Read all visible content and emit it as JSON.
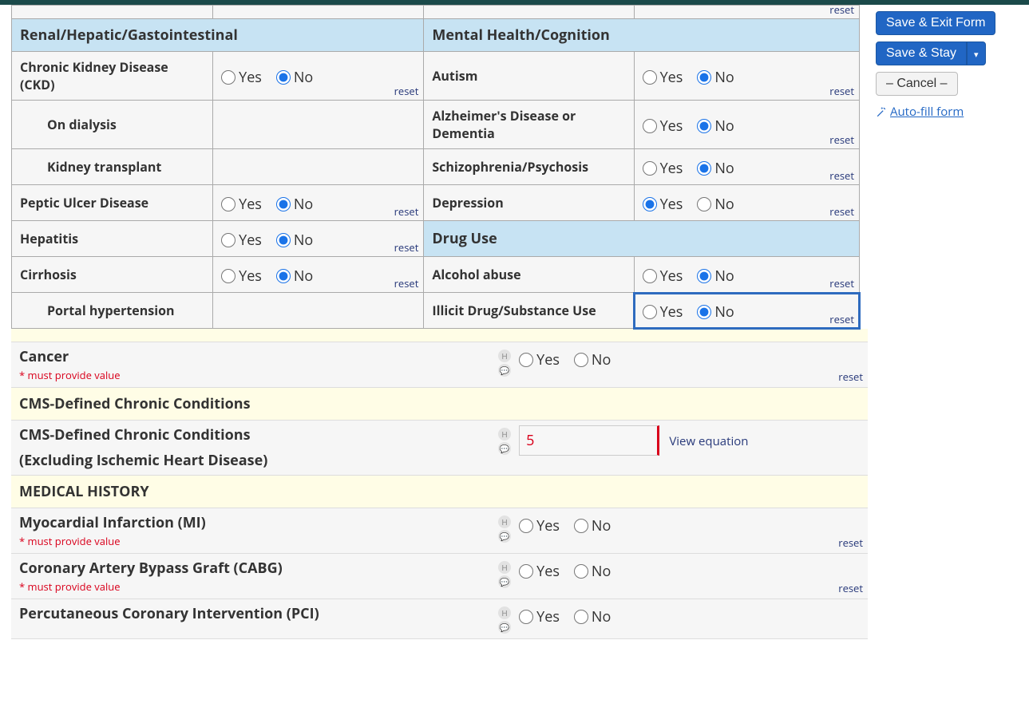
{
  "labels": {
    "yes": "Yes",
    "no": "No",
    "reset": "reset",
    "must": "* must provide value",
    "view_eq": "View equation"
  },
  "sections": {
    "renal_hdr": "Renal/Hepatic/Gastointestinal",
    "mental_hdr": "Mental Health/Cognition",
    "drug_hdr": "Drug Use"
  },
  "grid_left": [
    {
      "key": "ckd",
      "label": "Chronic Kidney Disease (CKD)",
      "selected": "no",
      "reset": true
    },
    {
      "key": "dialysis",
      "label": "On dialysis",
      "indent": true,
      "selected": null,
      "reset": false
    },
    {
      "key": "kidney_tx",
      "label": "Kidney transplant",
      "indent": true,
      "selected": null,
      "reset": false
    },
    {
      "key": "peptic",
      "label": "Peptic Ulcer Disease",
      "selected": "no",
      "reset": true
    },
    {
      "key": "hepatitis",
      "label": "Hepatitis",
      "selected": "no",
      "reset": true
    },
    {
      "key": "cirrhosis",
      "label": "Cirrhosis",
      "selected": "no",
      "reset": true
    },
    {
      "key": "portal_htn",
      "label": "Portal hypertension",
      "indent": true,
      "selected": null,
      "reset": false
    }
  ],
  "grid_right": [
    {
      "key": "autism",
      "label": "Autism",
      "selected": "no",
      "reset": true
    },
    {
      "key": "alz",
      "label": "Alzheimer's Disease or Dementia",
      "selected": "no",
      "reset": true
    },
    {
      "key": "schizo",
      "label": "Schizophrenia/Psychosis",
      "selected": "no",
      "reset": true
    },
    {
      "key": "depress",
      "label": "Depression",
      "selected": "yes",
      "reset": true
    },
    {
      "key": "alcohol",
      "label": "Alcohol abuse",
      "selected": "no",
      "reset": true
    },
    {
      "key": "illicit",
      "label": "Illicit Drug/Substance Use",
      "selected": "no",
      "reset": true,
      "highlight": true
    }
  ],
  "flat_rows": {
    "cancer": {
      "label": "Cancer",
      "must": true
    },
    "mi": {
      "label": "Myocardial Infarction (MI)",
      "must": true
    },
    "cabg": {
      "label": "Coronary Artery Bypass Graft (CABG)",
      "must": true
    },
    "pci": {
      "label": "Percutaneous Coronary Intervention (PCI)",
      "must": false
    }
  },
  "cms": {
    "banner": "CMS-Defined Chronic Conditions",
    "label": "CMS-Defined Chronic Conditions",
    "sublabel": "(Excluding Ischemic Heart Disease)",
    "value": "5"
  },
  "medhist_banner": "MEDICAL HISTORY",
  "sidebar": {
    "save_exit": "Save & Exit Form",
    "save_stay": "Save & Stay",
    "cancel": "– Cancel –",
    "autofill": " Auto-fill form"
  }
}
